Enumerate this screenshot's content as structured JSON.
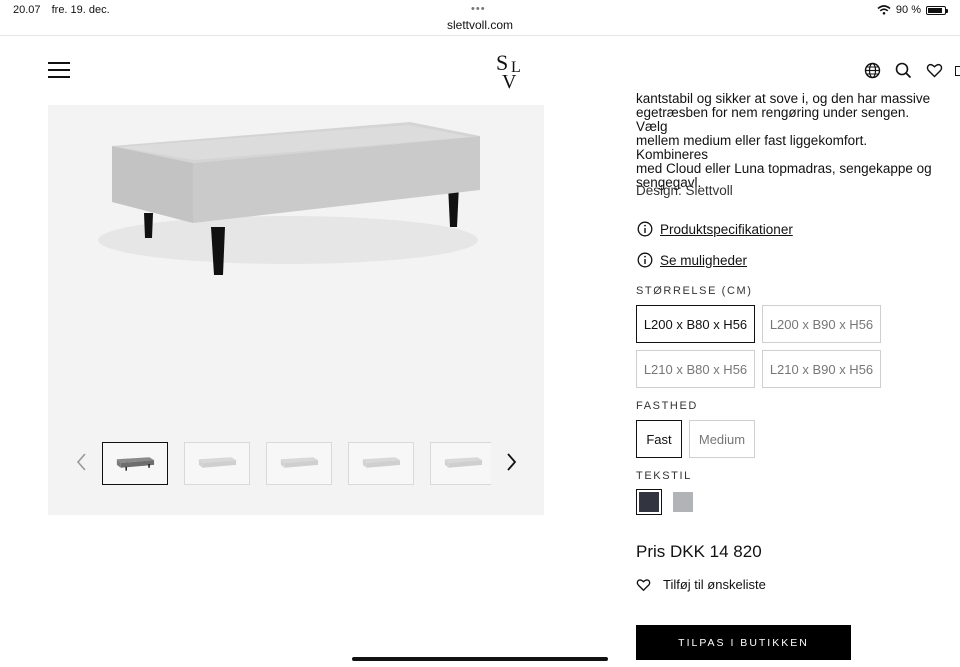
{
  "status_bar": {
    "time": "20.07",
    "date": "fre. 19. dec.",
    "url": "slettvoll.com",
    "battery": "90 %",
    "battery_level": 0.9
  },
  "header": {
    "logo_text": "SLV",
    "menu_icon": "hamburger-icon",
    "icons": [
      "globe-icon",
      "search-icon",
      "heart-icon"
    ]
  },
  "gallery": {
    "thumbnail_count": 5,
    "active_index": 0
  },
  "product": {
    "description_lines": [
      "kantstabil og sikker at sove i, og den har massive",
      "egetræsben for nem rengøring under sengen. Vælg",
      "mellem medium eller fast liggekomfort. Kombineres",
      "med Cloud eller Luna topmadras, sengekappe og",
      "sengegavl."
    ],
    "design": "Design: Slettvoll",
    "spec_link": "Produktspecifikationer",
    "options_link": "Se muligheder",
    "size_label": "STØRRELSE (CM)",
    "sizes": [
      "L200 x B80 x H56",
      "L200 x B90 x H56",
      "L210 x B80 x H56",
      "L210 x B90 x H56"
    ],
    "selected_size": 0,
    "firmness_label": "FASTHED",
    "firmness": [
      "Fast",
      "Medium"
    ],
    "selected_firmness": 0,
    "textile_label": "TEKSTIL",
    "textile_swatches": [
      "#32353f",
      "#b2b3b6"
    ],
    "selected_textile": 0,
    "price": "Pris DKK 14 820",
    "wishlist": "Tilføj til ønskeliste",
    "cta": "TILPAS I BUTIKKEN"
  }
}
